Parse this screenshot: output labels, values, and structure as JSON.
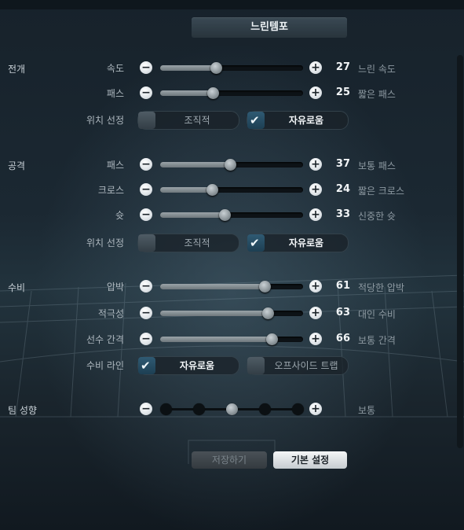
{
  "header": {
    "title": "느린템포"
  },
  "sections": {
    "buildup": "전개",
    "attack": "공격",
    "defense": "수비",
    "team": "팀 성향"
  },
  "sliders": [
    {
      "label": "속도",
      "value": "27",
      "desc": "느린 속도",
      "level": 0.27
    },
    {
      "label": "패스",
      "value": "25",
      "desc": "짧은 패스",
      "level": 0.25
    },
    {
      "label": "패스",
      "value": "37",
      "desc": "보통 패스",
      "level": 0.37
    },
    {
      "label": "크로스",
      "value": "24",
      "desc": "짧은 크로스",
      "level": 0.24
    },
    {
      "label": "슛",
      "value": "33",
      "desc": "신중한 슛",
      "level": 0.33
    },
    {
      "label": "압박",
      "value": "61",
      "desc": "적당한 압박",
      "level": 0.61
    },
    {
      "label": "적극성",
      "value": "63",
      "desc": "대인 수비",
      "level": 0.63
    },
    {
      "label": "선수 간격",
      "value": "66",
      "desc": "보통 간격",
      "level": 0.66
    }
  ],
  "options": [
    {
      "label": "위치 선정",
      "a": "조직적",
      "b": "자유로움",
      "selected": "b"
    },
    {
      "label": "위치 선정",
      "a": "조직적",
      "b": "자유로움",
      "selected": "b"
    },
    {
      "label": "수비 라인",
      "a": "자유로움",
      "b": "오프사이드 트랩",
      "selected": "a"
    }
  ],
  "team_style": {
    "steps": 5,
    "selected_step": 3,
    "desc": "보통"
  },
  "buttons": {
    "save": "저장하기",
    "default": "기본 설정"
  },
  "colors": {
    "accent": "#2f5a73",
    "background": "#1b2832"
  }
}
